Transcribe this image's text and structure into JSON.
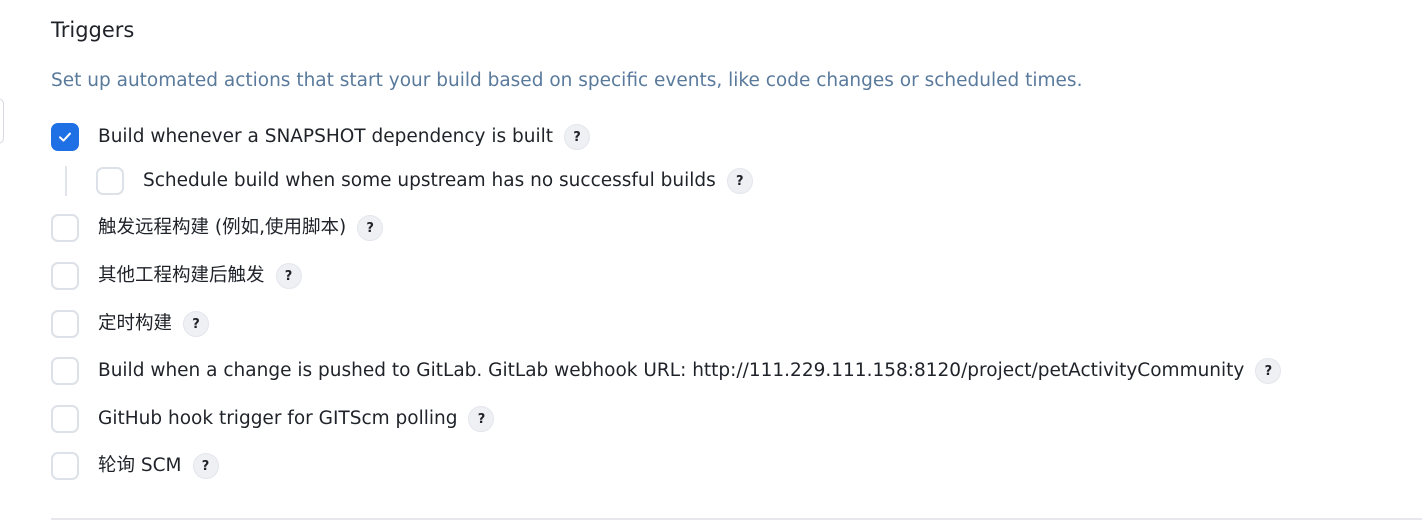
{
  "section": {
    "title": "Triggers",
    "description": "Set up automated actions that start your build based on specific events, like code changes or scheduled times."
  },
  "help_glyph": "?",
  "options": [
    {
      "label": "Build whenever a SNAPSHOT dependency is built",
      "checked": true
    },
    {
      "label": "Schedule build when some upstream has no successful builds",
      "checked": false,
      "nested": true
    },
    {
      "label": "触发远程构建 (例如,使用脚本)",
      "checked": false
    },
    {
      "label": "其他工程构建后触发",
      "checked": false
    },
    {
      "label": "定时构建",
      "checked": false
    },
    {
      "label": "Build when a change is pushed to GitLab. GitLab webhook URL: http://111.229.111.158:8120/project/petActivityCommunity",
      "checked": false
    },
    {
      "label": "GitHub hook trigger for GITScm polling",
      "checked": false
    },
    {
      "label": "轮询 SCM",
      "checked": false
    }
  ],
  "colors": {
    "accent": "#1f6fe5",
    "description_text": "#5a7a9c",
    "checkbox_border": "#dde1e8"
  }
}
